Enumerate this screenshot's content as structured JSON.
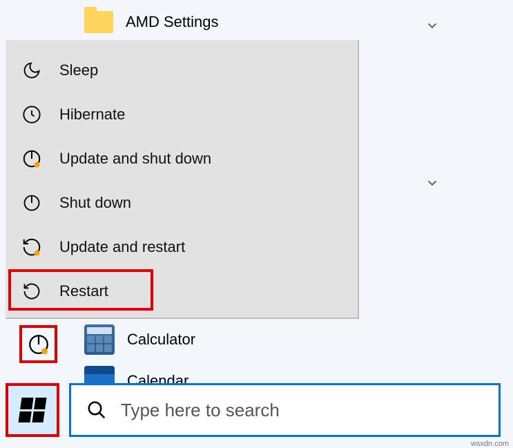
{
  "background": {
    "folder_label": "AMD Settings",
    "calc_label": "Calculator",
    "cal_label": "Calendar"
  },
  "power_menu": {
    "items": [
      {
        "label": "Sleep"
      },
      {
        "label": "Hibernate"
      },
      {
        "label": "Update and shut down"
      },
      {
        "label": "Shut down"
      },
      {
        "label": "Update and restart"
      },
      {
        "label": "Restart"
      }
    ]
  },
  "search": {
    "placeholder": "Type here to search"
  },
  "watermark": "wsxdn.com",
  "colors": {
    "accent": "#0576d8",
    "highlight": "#e20000",
    "menu_bg": "#e2e2e2",
    "update_dot": "#f6a400"
  }
}
